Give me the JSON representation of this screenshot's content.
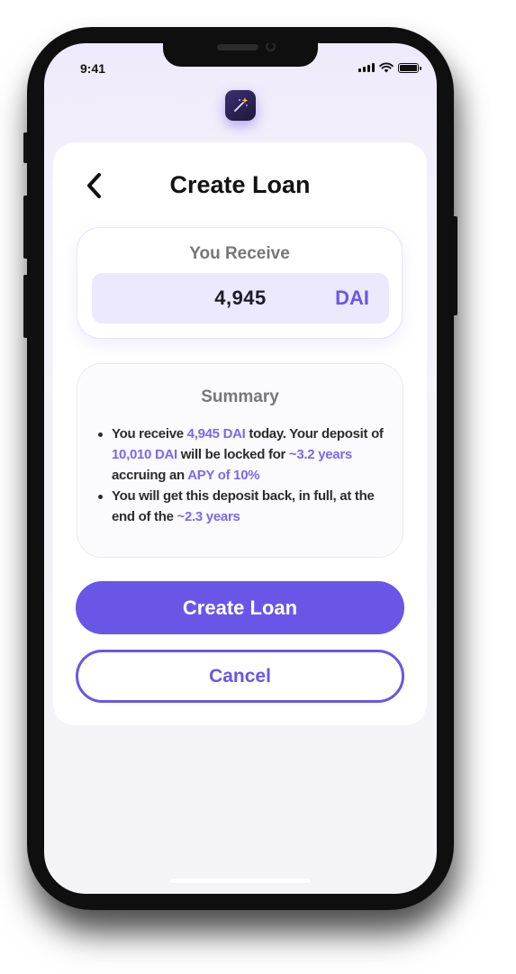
{
  "status_bar": {
    "time": "9:41"
  },
  "header": {
    "title": "Create Loan",
    "back_icon": "chevron-left-icon"
  },
  "receive": {
    "label": "You Receive",
    "amount": "4,945",
    "currency": "DAI"
  },
  "summary": {
    "title": "Summary",
    "items": [
      {
        "segments": [
          {
            "text": "You receive ",
            "highlight": false
          },
          {
            "text": "4,945 DAI",
            "highlight": true
          },
          {
            "text": " today. Your deposit of ",
            "highlight": false
          },
          {
            "text": "10,010 DAI",
            "highlight": true
          },
          {
            "text": " will be locked for ",
            "highlight": false
          },
          {
            "text": "~3.2 years",
            "highlight": true
          },
          {
            "text": " accruing an ",
            "highlight": false
          },
          {
            "text": "APY of 10%",
            "highlight": true
          }
        ]
      },
      {
        "segments": [
          {
            "text": "You will get this deposit back, in full, at the end of the ",
            "highlight": false
          },
          {
            "text": "~2.3 years",
            "highlight": true
          }
        ]
      }
    ]
  },
  "actions": {
    "primary_label": "Create Loan",
    "secondary_label": "Cancel"
  },
  "colors": {
    "accent": "#6a56e6",
    "accent_soft": "#ece8fd",
    "highlight_text": "#7c68ee"
  }
}
